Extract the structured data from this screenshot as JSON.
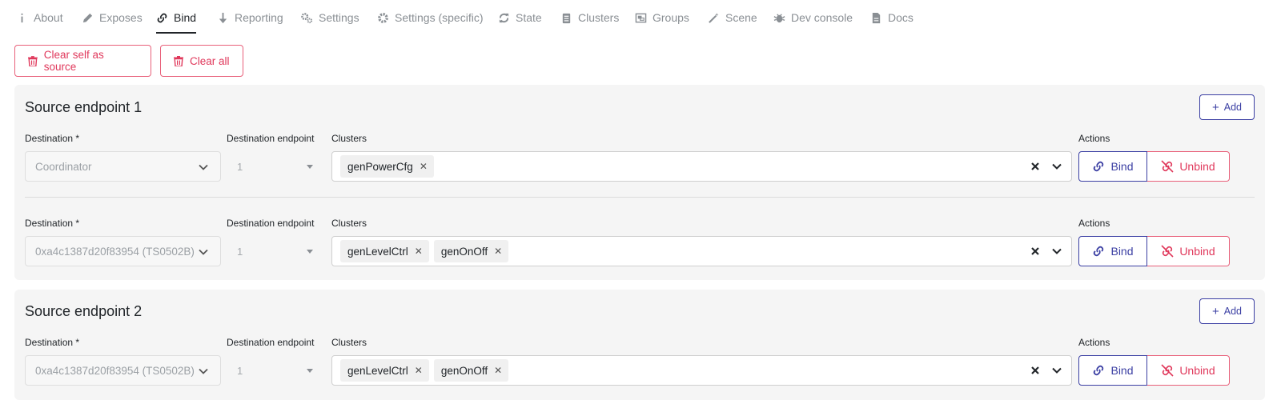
{
  "tabs": [
    {
      "label": "About",
      "icon": "info-icon"
    },
    {
      "label": "Exposes",
      "icon": "pencil-icon"
    },
    {
      "label": "Bind",
      "icon": "link-icon",
      "active": true
    },
    {
      "label": "Reporting",
      "icon": "arrow-down-icon"
    },
    {
      "label": "Settings",
      "icon": "cogs-icon"
    },
    {
      "label": "Settings (specific)",
      "icon": "cog-icon"
    },
    {
      "label": "State",
      "icon": "sync-icon"
    },
    {
      "label": "Clusters",
      "icon": "clipboard-icon"
    },
    {
      "label": "Groups",
      "icon": "object-group-icon"
    },
    {
      "label": "Scene",
      "icon": "magic-icon"
    },
    {
      "label": "Dev console",
      "icon": "bug-icon"
    },
    {
      "label": "Docs",
      "icon": "file-icon"
    }
  ],
  "toolbar": {
    "clear_self_label": "Clear self as source",
    "clear_all_label": "Clear all"
  },
  "labels": {
    "destination": "Destination *",
    "destination_endpoint": "Destination endpoint",
    "clusters": "Clusters",
    "actions": "Actions",
    "add": "Add",
    "bind": "Bind",
    "unbind": "Unbind"
  },
  "sources": [
    {
      "title": "Source endpoint 1",
      "rows": [
        {
          "destination": "Coordinator",
          "endpoint": "1",
          "clusters": [
            "genPowerCfg"
          ]
        },
        {
          "destination": "0xa4c1387d20f83954 (TS0502B)",
          "endpoint": "1",
          "clusters": [
            "genLevelCtrl",
            "genOnOff"
          ]
        }
      ]
    },
    {
      "title": "Source endpoint 2",
      "rows": [
        {
          "destination": "0xa4c1387d20f83954 (TS0502B)",
          "endpoint": "1",
          "clusters": [
            "genLevelCtrl",
            "genOnOff"
          ]
        }
      ]
    }
  ],
  "colors": {
    "primary": "#3b3fa3",
    "danger": "#e0385b",
    "card_bg": "#f5f5f5"
  }
}
